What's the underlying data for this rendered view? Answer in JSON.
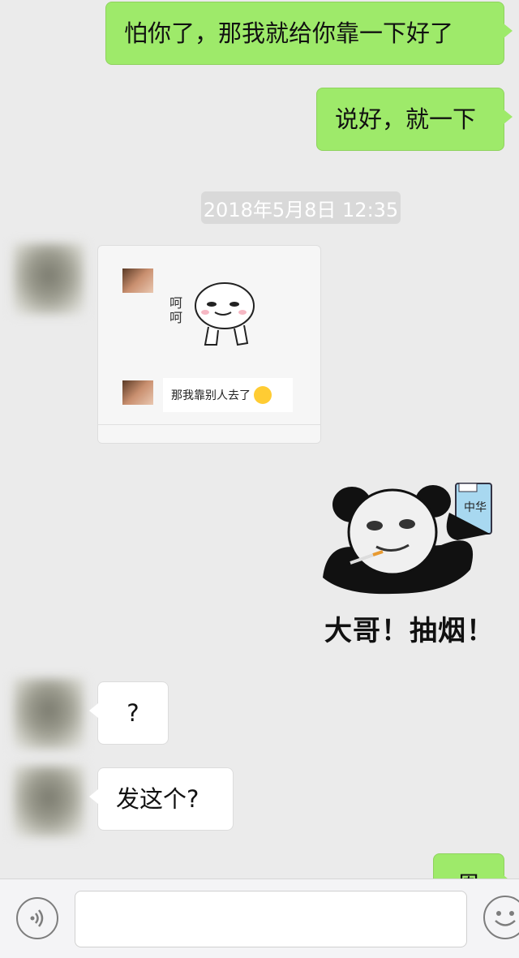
{
  "messages": {
    "m1": "怕你了，那我就给你靠一下好了",
    "m2": "说好，就一下",
    "timestamp": "2018年5月8日 12:35",
    "forward_card": {
      "sticker_text": "呵呵",
      "reply_text": "那我靠别人去了"
    },
    "sticker": {
      "pack_label": "中华",
      "caption": "大哥！抽烟！"
    },
    "m3": "?",
    "m4": "发这个?",
    "m5": "恩"
  },
  "input_bar": {
    "text_value": "",
    "icons": [
      "voice-icon",
      "emoji-icon"
    ]
  },
  "colors": {
    "my_bubble": "#9eea6a",
    "their_bubble": "#ffffff",
    "background": "#ebebeb"
  }
}
